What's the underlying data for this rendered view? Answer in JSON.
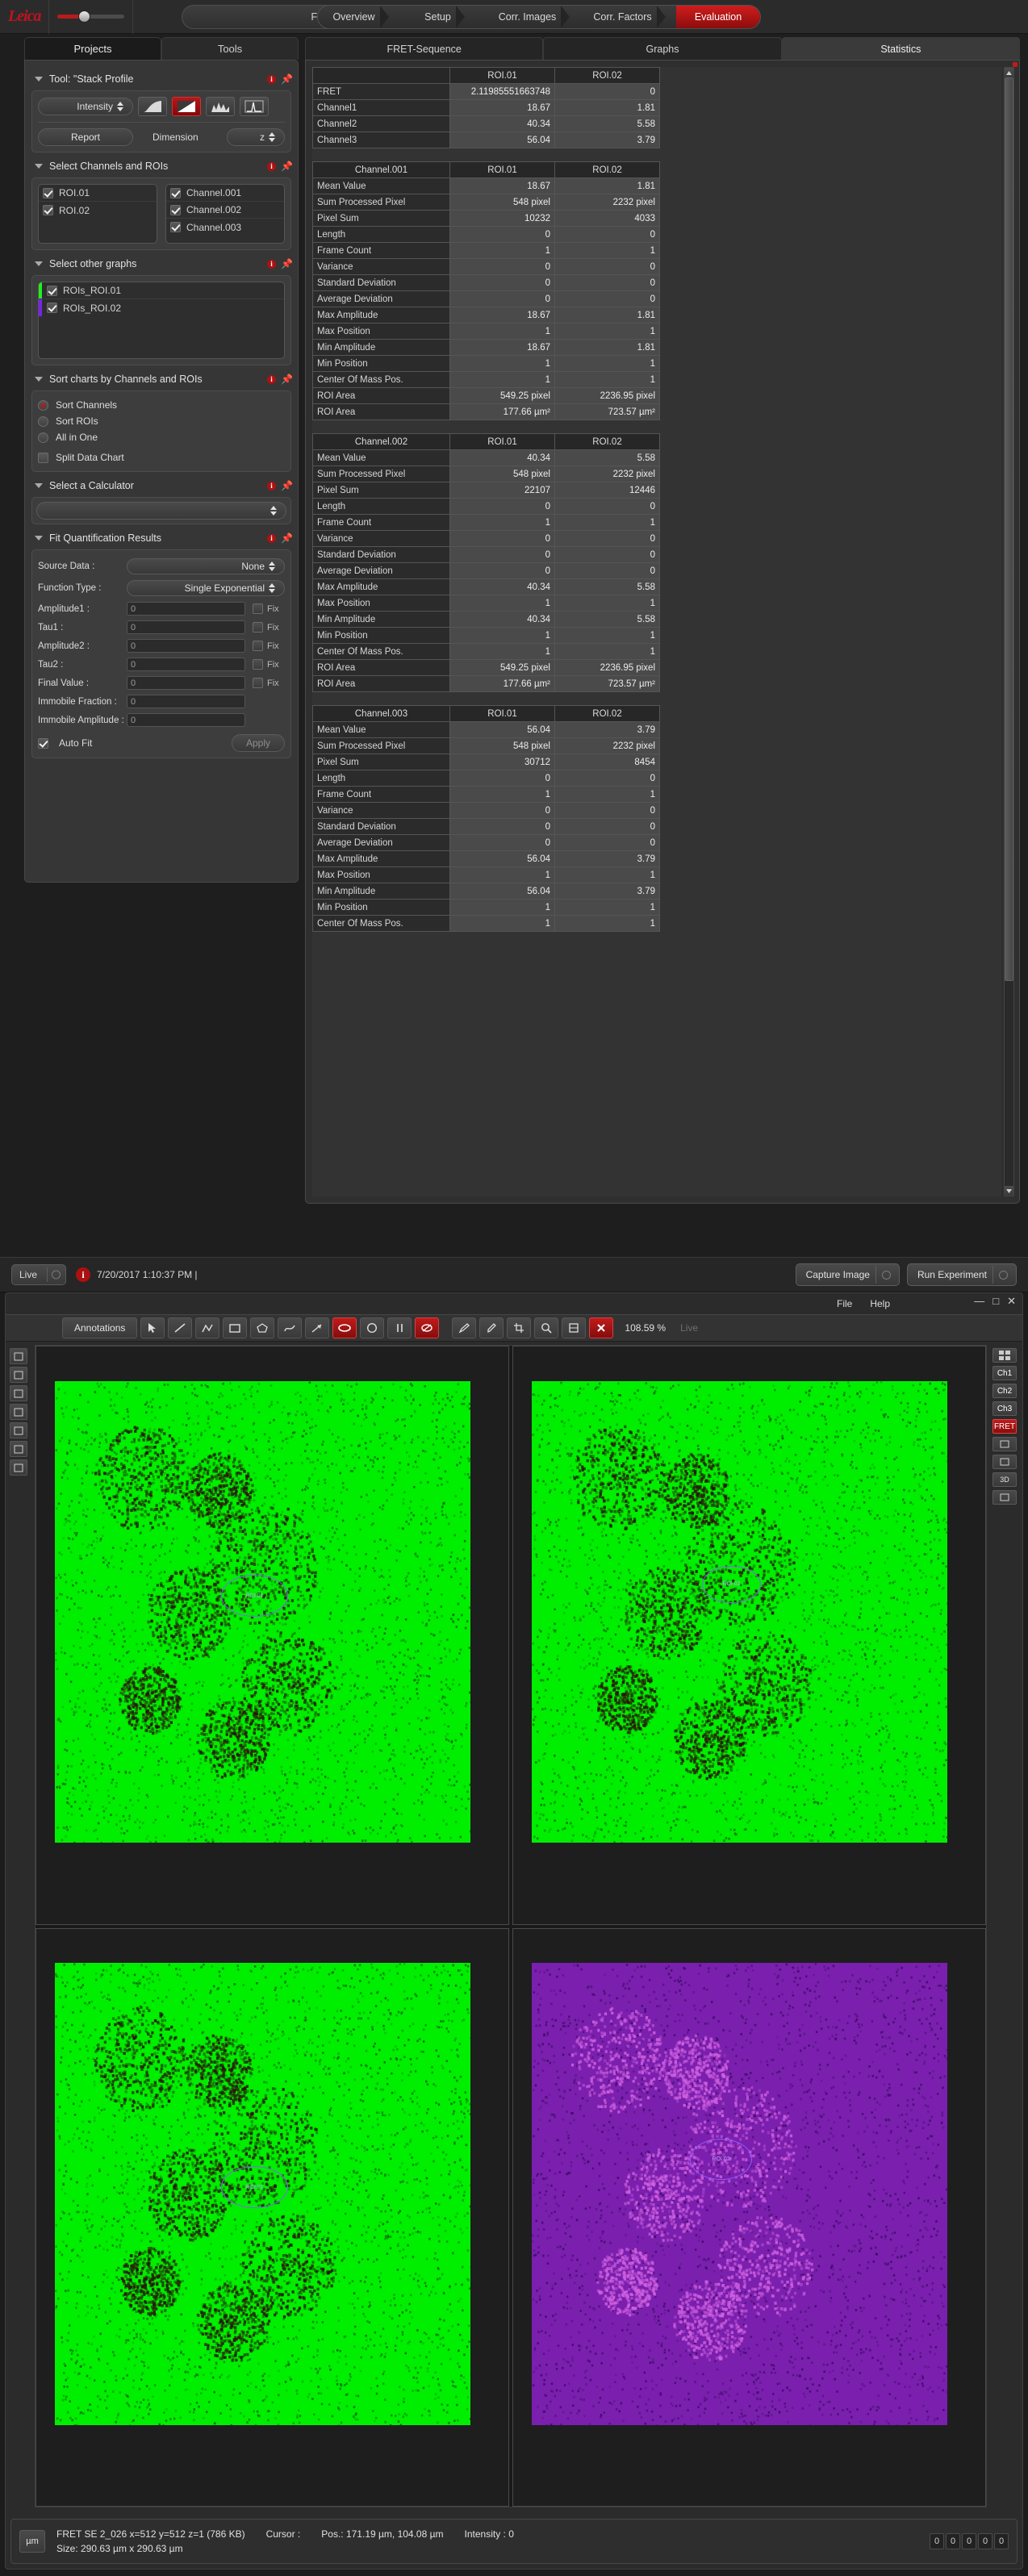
{
  "app": {
    "brand": "Leica",
    "mode_selector": "FRET SE",
    "window_controls": [
      "—",
      "□",
      "✕"
    ]
  },
  "nav": {
    "tabs": [
      {
        "label": "Overview",
        "active": false
      },
      {
        "label": "Setup",
        "active": false
      },
      {
        "label": "Corr. Images",
        "active": false
      },
      {
        "label": "Corr. Factors",
        "active": false
      },
      {
        "label": "Evaluation",
        "active": true
      }
    ]
  },
  "left_panel": {
    "tabs": [
      {
        "label": "Projects",
        "active": true
      },
      {
        "label": "Tools",
        "active": false
      }
    ],
    "tool_section": {
      "title": "Tool: \"Stack Profile",
      "mode_combo": "Intensity",
      "report_button": "Report",
      "dimension_label": "Dimension",
      "dimension_value": "z",
      "icons": [
        "curve-icon",
        "ramp-icon",
        "histogram-icon",
        "peak-icon"
      ]
    },
    "channels_section": {
      "title": "Select Channels and ROIs",
      "rois": [
        {
          "label": "ROI.01",
          "checked": true
        },
        {
          "label": "ROI.02",
          "checked": true
        }
      ],
      "channels": [
        {
          "label": "Channel.001",
          "checked": true
        },
        {
          "label": "Channel.002",
          "checked": true
        },
        {
          "label": "Channel.003",
          "checked": true
        }
      ]
    },
    "other_graphs_section": {
      "title": "Select other graphs",
      "items": [
        {
          "label": "ROIs_ROI.01",
          "checked": true,
          "color": "#22ee22"
        },
        {
          "label": "ROIs_ROI.02",
          "checked": true,
          "color": "#7a22ee"
        }
      ]
    },
    "sort_section": {
      "title": "Sort charts by Channels and ROIs",
      "radios": [
        {
          "label": "Sort Channels",
          "selected": true
        },
        {
          "label": "Sort ROIs",
          "selected": false
        },
        {
          "label": "All in One",
          "selected": false
        }
      ],
      "checkbox": {
        "label": "Split Data Chart",
        "checked": false
      }
    },
    "calculator_section": {
      "title": "Select a Calculator",
      "value": ""
    },
    "fit_section": {
      "title": "Fit Quantification Results",
      "source_data_label": "Source Data :",
      "source_data_value": "None",
      "function_type_label": "Function Type :",
      "function_type_value": "Single Exponential",
      "fields": [
        {
          "label": "Amplitude1 :",
          "value": "0",
          "fix": "Fix",
          "has_fix": true
        },
        {
          "label": "Tau1 :",
          "value": "0",
          "fix": "Fix",
          "has_fix": true
        },
        {
          "label": "Amplitude2 :",
          "value": "0",
          "fix": "Fix",
          "has_fix": true
        },
        {
          "label": "Tau2 :",
          "value": "0",
          "fix": "Fix",
          "has_fix": true
        },
        {
          "label": "Final Value :",
          "value": "0",
          "fix": "Fix",
          "has_fix": true
        },
        {
          "label": "Immobile Fraction :",
          "value": "0",
          "fix": "",
          "has_fix": false
        },
        {
          "label": "Immobile Amplitude :",
          "value": "0",
          "fix": "",
          "has_fix": false
        }
      ],
      "auto_fit_label": "Auto Fit",
      "auto_fit_checked": true,
      "apply_label": "Apply"
    }
  },
  "right_panel": {
    "tabs": [
      {
        "label": "FRET-Sequence",
        "active": false
      },
      {
        "label": "Graphs",
        "active": false
      },
      {
        "label": "Statistics",
        "active": true
      }
    ],
    "tables": [
      {
        "name": "fret-summary-table",
        "header": [
          "",
          "ROI.01",
          "ROI.02"
        ],
        "rows": [
          [
            "FRET",
            "2.11985551663748",
            "0"
          ],
          [
            "Channel1",
            "18.67",
            "1.81"
          ],
          [
            "Channel2",
            "40.34",
            "5.58"
          ],
          [
            "Channel3",
            "56.04",
            "3.79"
          ]
        ]
      },
      {
        "name": "channel-001-table",
        "header": [
          "Channel.001",
          "ROI.01",
          "ROI.02"
        ],
        "rows": [
          [
            "Mean Value",
            "18.67",
            "1.81"
          ],
          [
            "Sum Processed Pixel",
            "548 pixel",
            "2232 pixel"
          ],
          [
            "Pixel Sum",
            "10232",
            "4033"
          ],
          [
            "Length",
            "0",
            "0"
          ],
          [
            "Frame Count",
            "1",
            "1"
          ],
          [
            "Variance",
            "0",
            "0"
          ],
          [
            "Standard Deviation",
            "0",
            "0"
          ],
          [
            "Average Deviation",
            "0",
            "0"
          ],
          [
            "Max Amplitude",
            "18.67",
            "1.81"
          ],
          [
            "Max Position",
            "1",
            "1"
          ],
          [
            "Min Amplitude",
            "18.67",
            "1.81"
          ],
          [
            "Min Position",
            "1",
            "1"
          ],
          [
            "Center Of Mass Pos.",
            "1",
            "1"
          ],
          [
            "ROI Area",
            "549.25 pixel",
            "2236.95 pixel"
          ],
          [
            "ROI Area",
            "177.66 µm²",
            "723.57 µm²"
          ]
        ]
      },
      {
        "name": "channel-002-table",
        "header": [
          "Channel.002",
          "ROI.01",
          "ROI.02"
        ],
        "rows": [
          [
            "Mean Value",
            "40.34",
            "5.58"
          ],
          [
            "Sum Processed Pixel",
            "548 pixel",
            "2232 pixel"
          ],
          [
            "Pixel Sum",
            "22107",
            "12446"
          ],
          [
            "Length",
            "0",
            "0"
          ],
          [
            "Frame Count",
            "1",
            "1"
          ],
          [
            "Variance",
            "0",
            "0"
          ],
          [
            "Standard Deviation",
            "0",
            "0"
          ],
          [
            "Average Deviation",
            "0",
            "0"
          ],
          [
            "Max Amplitude",
            "40.34",
            "5.58"
          ],
          [
            "Max Position",
            "1",
            "1"
          ],
          [
            "Min Amplitude",
            "40.34",
            "5.58"
          ],
          [
            "Min Position",
            "1",
            "1"
          ],
          [
            "Center Of Mass Pos.",
            "1",
            "1"
          ],
          [
            "ROI Area",
            "549.25 pixel",
            "2236.95 pixel"
          ],
          [
            "ROI Area",
            "177.66 µm²",
            "723.57 µm²"
          ]
        ]
      },
      {
        "name": "channel-003-table",
        "header": [
          "Channel.003",
          "ROI.01",
          "ROI.02"
        ],
        "rows": [
          [
            "Mean Value",
            "56.04",
            "3.79"
          ],
          [
            "Sum Processed Pixel",
            "548 pixel",
            "2232 pixel"
          ],
          [
            "Pixel Sum",
            "30712",
            "8454"
          ],
          [
            "Length",
            "0",
            "0"
          ],
          [
            "Frame Count",
            "1",
            "1"
          ],
          [
            "Variance",
            "0",
            "0"
          ],
          [
            "Standard Deviation",
            "0",
            "0"
          ],
          [
            "Average Deviation",
            "0",
            "0"
          ],
          [
            "Max Amplitude",
            "56.04",
            "3.79"
          ],
          [
            "Max Position",
            "1",
            "1"
          ],
          [
            "Min Amplitude",
            "56.04",
            "3.79"
          ],
          [
            "Min Position",
            "1",
            "1"
          ],
          [
            "Center Of Mass Pos.",
            "1",
            "1"
          ]
        ]
      }
    ]
  },
  "mid_bar": {
    "live_label": "Live",
    "status_message": "7/20/2017 1:10:37 PM |",
    "capture_button": "Capture Image",
    "run_button": "Run Experiment"
  },
  "image_window": {
    "menu": [
      "File",
      "Help"
    ],
    "toolbar": {
      "annotations_label": "Annotations",
      "zoom_level": "108.59 %",
      "live_label": "Live",
      "icons": [
        "pointer-icon",
        "line-icon",
        "polyline-icon",
        "rect-icon",
        "polygon-icon",
        "freehand-icon",
        "arrow-icon",
        "ellipse-filled-icon",
        "circle-icon",
        "bean-icon",
        "parallel-icon",
        "delete-icon",
        "pen-icon",
        "dropper-icon",
        "crop-icon",
        "magnify-icon",
        "zoom-fit-icon",
        "close-red-icon"
      ]
    },
    "left_rail": [
      "overlay-icon",
      "layers-icon",
      "tile-icon",
      "gallery-icon",
      "text-icon",
      "scale-icon",
      "chart-icon"
    ],
    "right_rail": {
      "grid": "grid-icon",
      "channels": [
        {
          "label": "Ch1",
          "active": false
        },
        {
          "label": "Ch2",
          "active": false
        },
        {
          "label": "Ch3",
          "active": false
        },
        {
          "label": "FRET",
          "active": true
        }
      ],
      "extras": [
        "stack-icon",
        "xy-icon",
        "3D",
        "export-icon"
      ]
    },
    "panels": [
      {
        "name": "panel-ch1",
        "roi_label": "ROI.01",
        "bg": "#00ee00",
        "mode": "green"
      },
      {
        "name": "panel-ch2",
        "roi_label": "ROI.02",
        "bg": "#00ee00",
        "mode": "green"
      },
      {
        "name": "panel-ch3",
        "roi_label": "ROI.01",
        "bg": "#00ee00",
        "mode": "green"
      },
      {
        "name": "panel-fret",
        "roi_label": "ROI.02",
        "bg": "#7a1fae",
        "mode": "purple"
      }
    ],
    "status": {
      "unit_button": "µm",
      "file_info": "FRET SE 2_026 x=512 y=512 z=1  (786 KB)",
      "cursor_label": "Cursor :",
      "cursor_pos": "Pos.: 171.19 µm, 104.08 µm",
      "intensity": "Intensity : 0",
      "size_info": "Size: 290.63 µm x 290.63 µm",
      "counters": [
        "0",
        "0",
        "0",
        "0",
        "0"
      ]
    }
  }
}
